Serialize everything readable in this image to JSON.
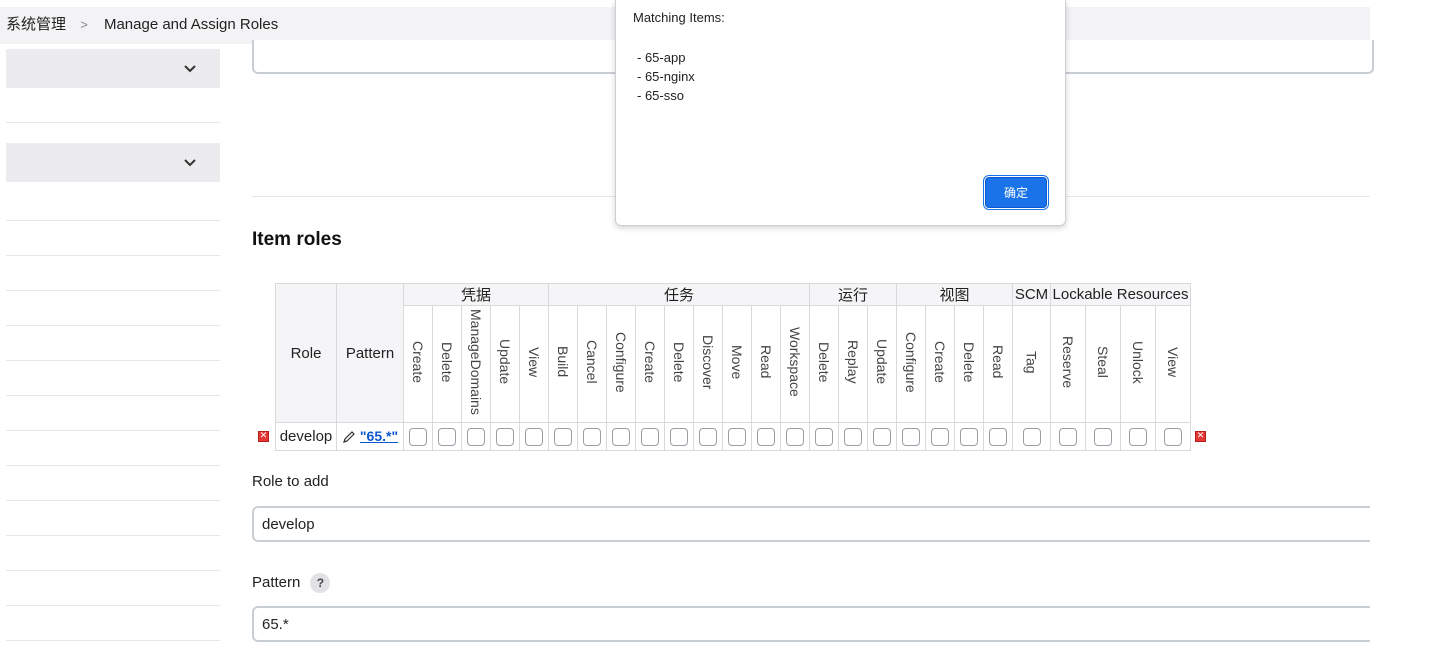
{
  "breadcrumb": {
    "root": "系统管理",
    "current": "Manage and Assign Roles"
  },
  "dialog": {
    "title": "Matching Items:",
    "items": [
      "- 65-app",
      "- 65-nginx",
      "- 65-sso"
    ],
    "ok_label": "确定"
  },
  "section": {
    "title": "Item roles"
  },
  "table": {
    "role_header": "Role",
    "pattern_header": "Pattern",
    "groups": [
      {
        "label": "凭据",
        "perms": [
          "Create",
          "Delete",
          "ManageDomains",
          "Update",
          "View"
        ]
      },
      {
        "label": "任务",
        "perms": [
          "Build",
          "Cancel",
          "Configure",
          "Create",
          "Delete",
          "Discover",
          "Move",
          "Read",
          "Workspace"
        ]
      },
      {
        "label": "运行",
        "perms": [
          "Delete",
          "Replay",
          "Update"
        ]
      },
      {
        "label": "视图",
        "perms": [
          "Configure",
          "Create",
          "Delete",
          "Read"
        ]
      },
      {
        "label": "SCM",
        "perms": [
          "Tag"
        ]
      },
      {
        "label": "Lockable Resources",
        "perms": [
          "Reserve",
          "Steal",
          "Unlock",
          "View"
        ]
      }
    ],
    "rows": [
      {
        "role": "develop",
        "pattern": "\"65.*\""
      }
    ]
  },
  "role_to_add": {
    "label": "Role to add",
    "value": "develop"
  },
  "pattern_field": {
    "label": "Pattern",
    "help": "?",
    "value": "65.*"
  },
  "colors": {
    "accent": "#1a73e8",
    "delete": "#e53935",
    "link": "#0b57d0"
  }
}
